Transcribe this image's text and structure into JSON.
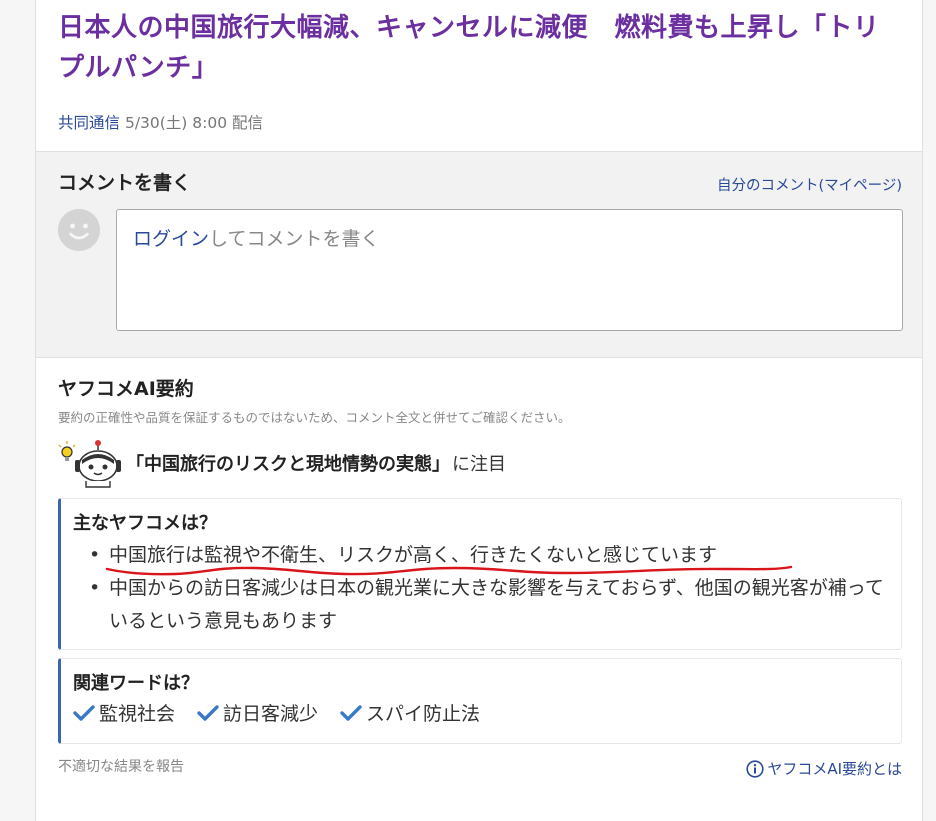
{
  "article": {
    "title": "日本人の中国旅行大幅減、キャンセルに減便　燃料費も上昇し「トリプルパンチ」",
    "source": "共同通信",
    "datetime": "5/30(土) 8:00",
    "delivery": "配信"
  },
  "comment": {
    "heading": "コメントを書く",
    "mypage_link": "自分のコメント(マイページ)",
    "login_link": "ログイン",
    "placeholder": "してコメントを書く"
  },
  "ai_summary": {
    "title": "ヤフコメAI要約",
    "disclaimer": "要約の正確性や品質を保証するものではないため、コメント全文と併せてご確認ください。",
    "focus_topic": "「中国旅行のリスクと現地情勢の実態」",
    "focus_suffix": "に注目",
    "main_heading": "主なヤフコメは？",
    "main_points": [
      "中国旅行は監視や不衛生、リスクが高く、行きたくないと感じています",
      "中国からの訪日客減少は日本の観光業に大きな影響を与えておらず、他国の観光客が補っているという意見もあります"
    ],
    "words_heading": "関連ワードは？",
    "related_words": [
      "監視社会",
      "訪日客減少",
      "スパイ防止法"
    ],
    "report_link": "不適切な結果を報告",
    "about_link": "ヤフコメAI要約とは"
  },
  "colors": {
    "title": "#6b2fa0",
    "link": "#2a4a98",
    "accent_border": "#3a64b0",
    "check": "#3a78c8",
    "annotation": "#d9141a"
  }
}
